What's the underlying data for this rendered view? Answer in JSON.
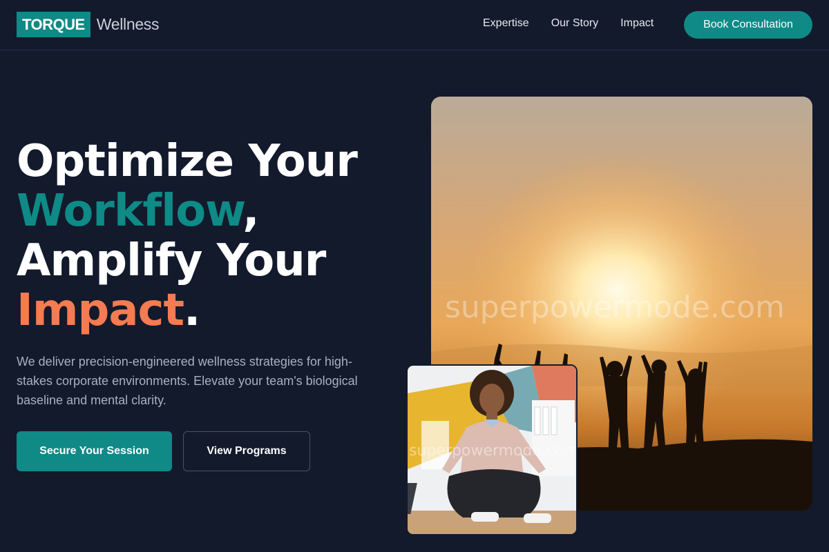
{
  "brand": {
    "logo_box": "TORQUE",
    "logo_word": "Wellness",
    "accent": "#0f8a86",
    "highlight": "#f47b52"
  },
  "nav": {
    "links": [
      "Expertise",
      "Our Story",
      "Impact"
    ],
    "cta": "Book Consultation"
  },
  "hero": {
    "line1": "Optimize Your",
    "line2_accent": "Workflow",
    "line2_punct": ",",
    "line3": "Amplify Your",
    "line4_accent": "Impact",
    "line4_punct": ".",
    "subtext": "We deliver precision-engineered wellness strategies for high-stakes corporate environments. Elevate your team's biological baseline and mental clarity.",
    "primary_button": "Secure Your Session",
    "secondary_button": "View Programs"
  },
  "images": {
    "main_watermark": "superpowermode.com",
    "small_watermark": "superpowermode.com"
  }
}
